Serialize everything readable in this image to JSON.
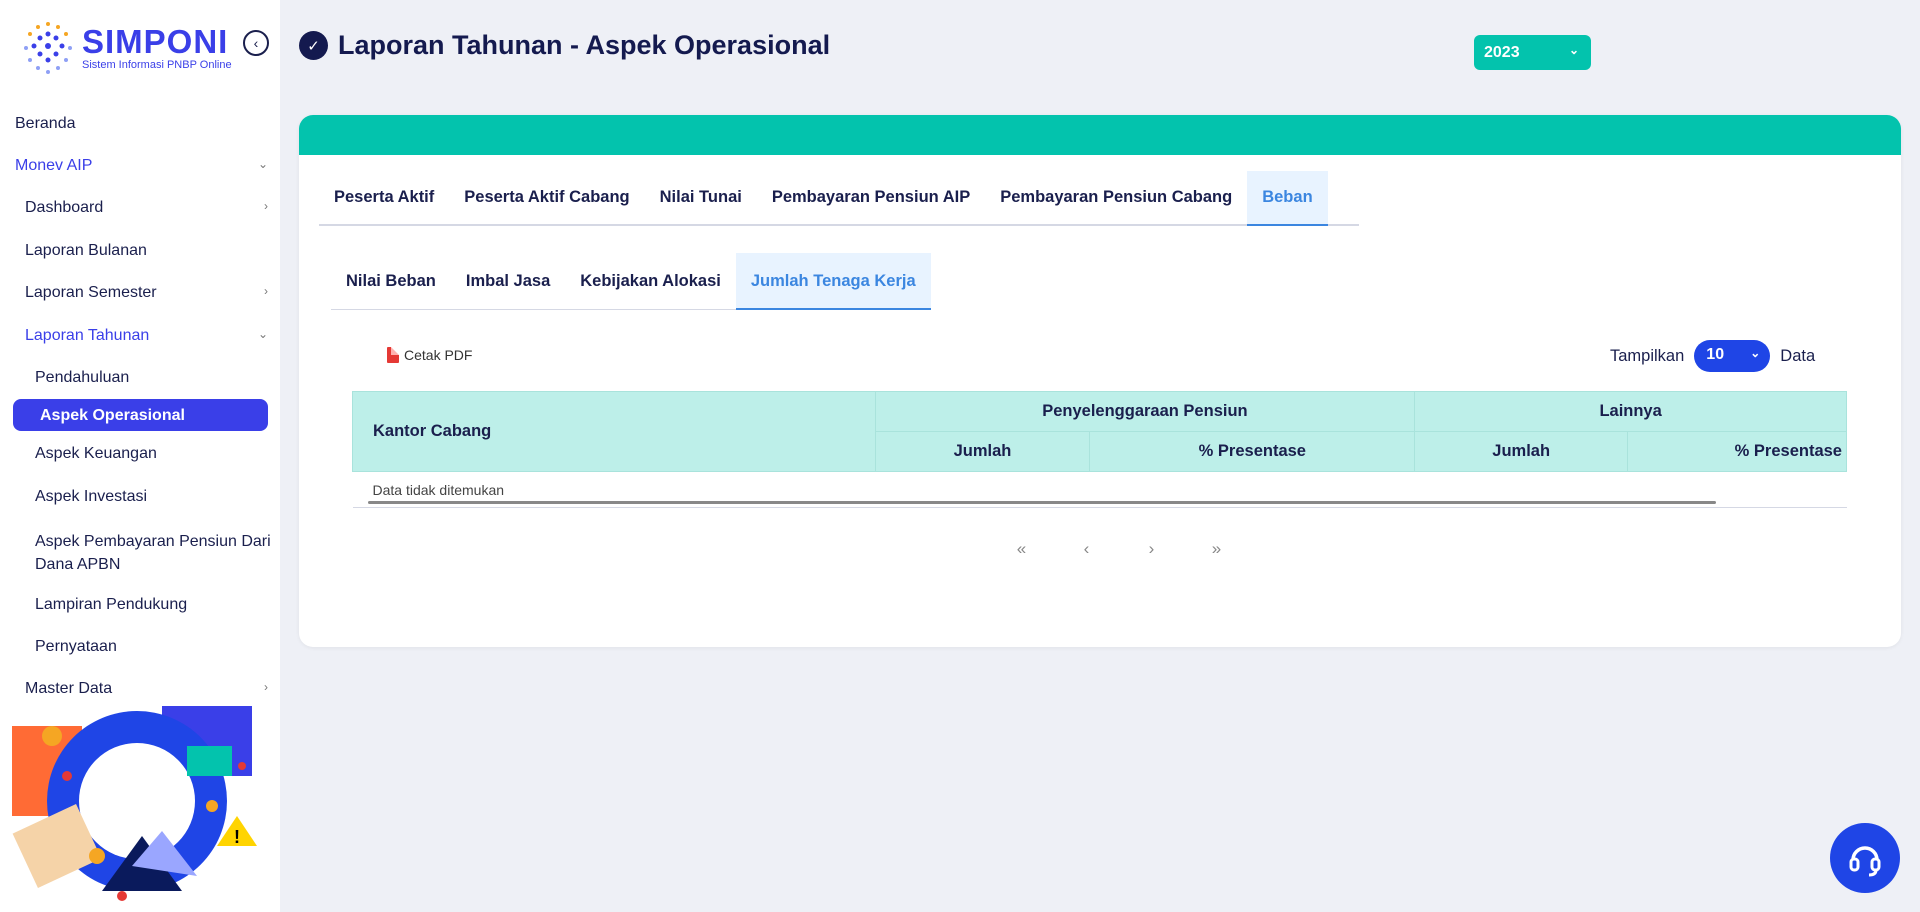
{
  "app": {
    "logo_title": "SIMPONI",
    "logo_subtitle": "Sistem Informasi PNBP Online"
  },
  "sidebar": {
    "items": [
      {
        "label": "Beranda"
      },
      {
        "label": "Monev AIP"
      },
      {
        "label": "Dashboard"
      },
      {
        "label": "Laporan Bulanan"
      },
      {
        "label": "Laporan Semester"
      },
      {
        "label": "Laporan Tahunan"
      },
      {
        "label": "Pendahuluan"
      },
      {
        "label": "Aspek Operasional"
      },
      {
        "label": "Aspek Keuangan"
      },
      {
        "label": "Aspek Investasi"
      },
      {
        "label": "Aspek Pembayaran Pensiun Dari"
      },
      {
        "label": "Dana APBN"
      },
      {
        "label": "Lampiran Pendukung"
      },
      {
        "label": "Pernyataan"
      },
      {
        "label": "Master Data"
      }
    ]
  },
  "header": {
    "title": "Laporan Tahunan - Aspek Operasional",
    "year": "2023"
  },
  "tabs": [
    "Peserta Aktif",
    "Peserta Aktif Cabang",
    "Nilai Tunai",
    "Pembayaran Pensiun AIP",
    "Pembayaran Pensiun Cabang",
    "Beban"
  ],
  "subtabs": [
    "Nilai Beban",
    "Imbal Jasa",
    "Kebijakan Alokasi",
    "Jumlah Tenaga Kerja"
  ],
  "toolbar": {
    "pdf_label": "Cetak PDF",
    "show_label": "Tampilkan",
    "show_value": "10",
    "data_label": "Data"
  },
  "table": {
    "col_kantor": "Kantor Cabang",
    "group1": "Penyelenggaraan Pensiun",
    "group2": "Lainnya",
    "sub_jumlah": "Jumlah",
    "sub_presentase": "% Presentase",
    "empty": "Data tidak ditemukan"
  },
  "pager": {
    "first": "«",
    "prev": "‹",
    "next": "›",
    "last": "»"
  },
  "colors": {
    "accent": "#03c3ad",
    "primary": "#1f45e6",
    "active_nav": "#3a3fe8"
  },
  "icons": [
    "back-circle-icon",
    "check-circle-icon",
    "chevron-down-icon",
    "chevron-right-icon",
    "pdf-icon",
    "headset-icon"
  ]
}
